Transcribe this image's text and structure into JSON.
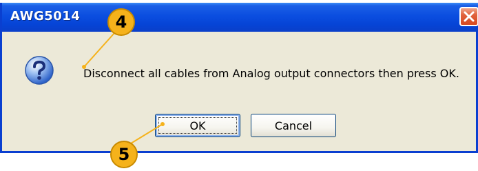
{
  "window": {
    "title": "AWG5014"
  },
  "dialog": {
    "message": "Disconnect all cables from Analog output connectors then press OK.",
    "ok_label": "OK",
    "cancel_label": "Cancel"
  },
  "callouts": {
    "first": "4",
    "second": "5"
  },
  "icons": {
    "dialog_icon": "question-icon",
    "close": "close-icon"
  },
  "colors": {
    "titlebar": "#0b4ee0",
    "dialog_bg": "#ece9d8",
    "close_button": "#d8471f",
    "callout": "#f5b21b"
  }
}
